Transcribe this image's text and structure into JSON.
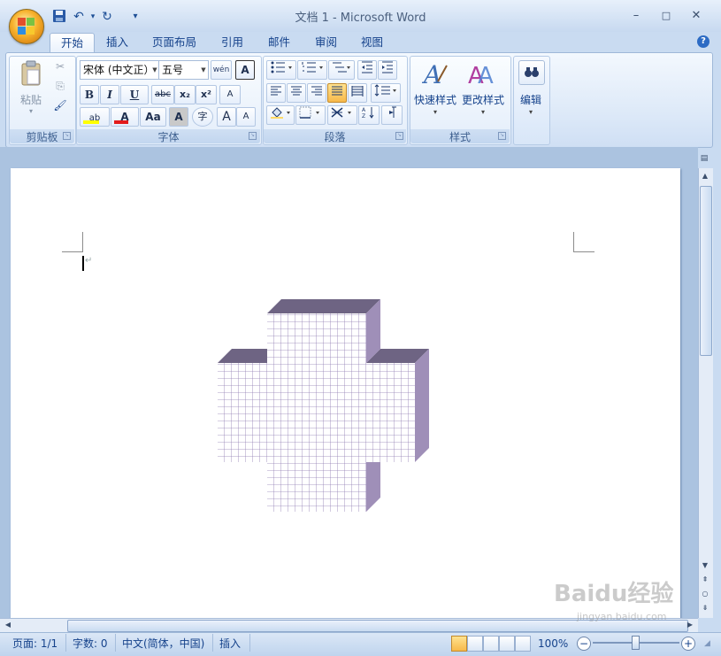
{
  "window": {
    "title": "文档 1 - Microsoft Word",
    "controls": {
      "minimize": "–",
      "maximize": "□",
      "close": "✕"
    }
  },
  "quick_access": [
    {
      "name": "save-icon",
      "glyph": "💾"
    },
    {
      "name": "undo-icon",
      "glyph": "↶"
    },
    {
      "name": "redo-icon",
      "glyph": "↻"
    },
    {
      "name": "customize-qat-icon",
      "glyph": "▾"
    }
  ],
  "tabs": [
    "开始",
    "插入",
    "页面布局",
    "引用",
    "邮件",
    "审阅",
    "视图"
  ],
  "help_glyph": "?",
  "ribbon": {
    "clipboard": {
      "label": "剪贴板",
      "paste_label": "粘贴",
      "cut_glyph": "✂",
      "copy_glyph": "⎘",
      "format_painter_glyph": "🖌"
    },
    "font": {
      "label": "字体",
      "font_name": "宋体 (中文正）",
      "font_size": "五号",
      "pinyin_glyph": "wén",
      "border_glyph": "A",
      "bold": "B",
      "italic": "I",
      "underline": "U",
      "strike": "abc",
      "subscript": "x₂",
      "superscript": "x²",
      "clear_format": "A",
      "highlight": "ab",
      "font_color": "A",
      "change_case": "Aa",
      "char_shading": "A",
      "enclose": "字",
      "grow": "A",
      "shrink": "A"
    },
    "paragraph": {
      "label": "段落"
    },
    "styles": {
      "label": "样式",
      "quick_styles": "快速样式",
      "change_styles": "更改样式"
    },
    "editing": {
      "label": "编辑"
    }
  },
  "status": {
    "page": "页面: 1/1",
    "words": "字数: 0",
    "language": "中文(简体，中国)",
    "mode": "插入",
    "zoom": "100%",
    "zoom_out": "−",
    "zoom_in": "+"
  },
  "watermark": {
    "brand": "Baidu经验",
    "url": "jingyan.baidu.com"
  },
  "colors": {
    "accent": "#15428b",
    "shape_face": "#9f8fb8",
    "shape_top": "#6e6483",
    "grid_line": "#8f7cb1"
  }
}
